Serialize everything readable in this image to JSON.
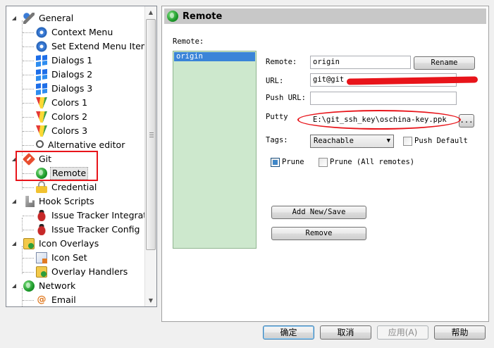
{
  "tree": {
    "items": [
      {
        "label": "General",
        "icon": "tools-icon",
        "level": 0,
        "expanded": true
      },
      {
        "label": "Context Menu",
        "icon": "gear-icon",
        "level": 1
      },
      {
        "label": "Set Extend Menu Item",
        "icon": "gear-icon",
        "level": 1
      },
      {
        "label": "Dialogs 1",
        "icon": "windows-icon",
        "level": 1
      },
      {
        "label": "Dialogs 2",
        "icon": "windows-icon",
        "level": 1
      },
      {
        "label": "Dialogs 3",
        "icon": "windows-icon",
        "level": 1
      },
      {
        "label": "Colors 1",
        "icon": "colors-icon",
        "level": 1
      },
      {
        "label": "Colors 2",
        "icon": "colors-icon",
        "level": 1
      },
      {
        "label": "Colors 3",
        "icon": "colors-icon",
        "level": 1
      },
      {
        "label": "Alternative editor",
        "icon": "search-icon",
        "level": 1
      },
      {
        "label": "Git",
        "icon": "git-icon",
        "level": 0,
        "expanded": true
      },
      {
        "label": "Remote",
        "icon": "globe-icon",
        "level": 1,
        "selected": true
      },
      {
        "label": "Credential",
        "icon": "lock-icon",
        "level": 1
      },
      {
        "label": "Hook Scripts",
        "icon": "hook-icon",
        "level": 0,
        "expanded": true
      },
      {
        "label": "Issue Tracker Integrati",
        "icon": "bug-icon",
        "level": 1
      },
      {
        "label": "Issue Tracker Config",
        "icon": "bug-icon",
        "level": 1
      },
      {
        "label": "Icon Overlays",
        "icon": "overlay-icon",
        "level": 0,
        "expanded": true
      },
      {
        "label": "Icon Set",
        "icon": "iconset-icon",
        "level": 1
      },
      {
        "label": "Overlay Handlers",
        "icon": "overlay-icon",
        "level": 1
      },
      {
        "label": "Network",
        "icon": "globe-icon",
        "level": 0,
        "expanded": true
      },
      {
        "label": "Email",
        "icon": "email-icon",
        "level": 1
      }
    ]
  },
  "panel": {
    "title": "Remote",
    "remote_list_label": "Remote:",
    "remotes": [
      "origin"
    ],
    "remote_label": "Remote:",
    "remote_value": "origin",
    "rename_label": "Rename",
    "url_label": "URL:",
    "url_value": "git@git",
    "push_url_label": "Push URL:",
    "push_url_value": "",
    "putty_label": "Putty",
    "putty_value": "E:\\git_ssh_key\\oschina-key.ppk",
    "browse_label": "...",
    "tags_label": "Tags:",
    "tags_value": "Reachable",
    "push_default_label": "Push Default",
    "push_default_checked": false,
    "prune_label": "Prune",
    "prune_checked": true,
    "prune_all_label": "Prune (All remotes)",
    "prune_all_checked": false,
    "add_label": "Add New/Save",
    "remove_label": "Remove"
  },
  "dialog": {
    "ok_label": "确定",
    "cancel_label": "取消",
    "apply_label": "应用(A)",
    "help_label": "帮助"
  },
  "colors": {
    "annotation_red": "#e8141a",
    "selection_blue": "#3a84d8",
    "remote_list_bg": "#cde8cd"
  }
}
